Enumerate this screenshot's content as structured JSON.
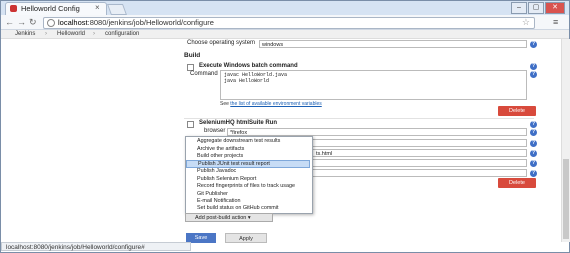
{
  "browser": {
    "tab_title": "Helloworld Config",
    "tab_close": "×",
    "url_host": "localhost",
    "url_rest": ":8080/jenkins/job/Helloworld/configure",
    "window_min": "–",
    "window_max": "▢",
    "window_close": "✕"
  },
  "breadcrumb": [
    "Jenkins",
    "Helloworld",
    "configuration"
  ],
  "config": {
    "os_label": "Choose operating system",
    "os_value": "windows",
    "build_section": "Build",
    "batch_title": "Execute Windows batch command",
    "command_label": "Command",
    "command_lines": [
      "javac HelloWorld.java",
      "java HelloWorld"
    ],
    "env_see": "See ",
    "env_link": "the list of available environment variables",
    "delete_label": "Delete",
    "selenium_title": "SeleniumHQ htmlSuite Run",
    "browser_label": "browser",
    "browser_value": "*firefox",
    "partial_value": "ts.html",
    "delete2_label": "Delete"
  },
  "post_build_menu": {
    "items": [
      "Aggregate downstream test results",
      "Archive the artifacts",
      "Build other projects",
      "Publish JUnit test result report",
      "Publish Javadoc",
      "Publish Selenium Report",
      "Record fingerprints of files to track usage",
      "Git Publisher",
      "E-mail Notification",
      "Set build status on GitHub commit"
    ],
    "selected_index": 3
  },
  "actions": {
    "add_post_build": "Add post-build action ▾",
    "save": "Save",
    "apply": "Apply"
  },
  "status_bar": "localhost:8080/jenkins/job/Helloworld/configure#",
  "colors": {
    "delete": "#d84a3c",
    "save": "#4b76c5",
    "help": "#3f6fc6",
    "menu_highlight": "#c7dcf5"
  }
}
